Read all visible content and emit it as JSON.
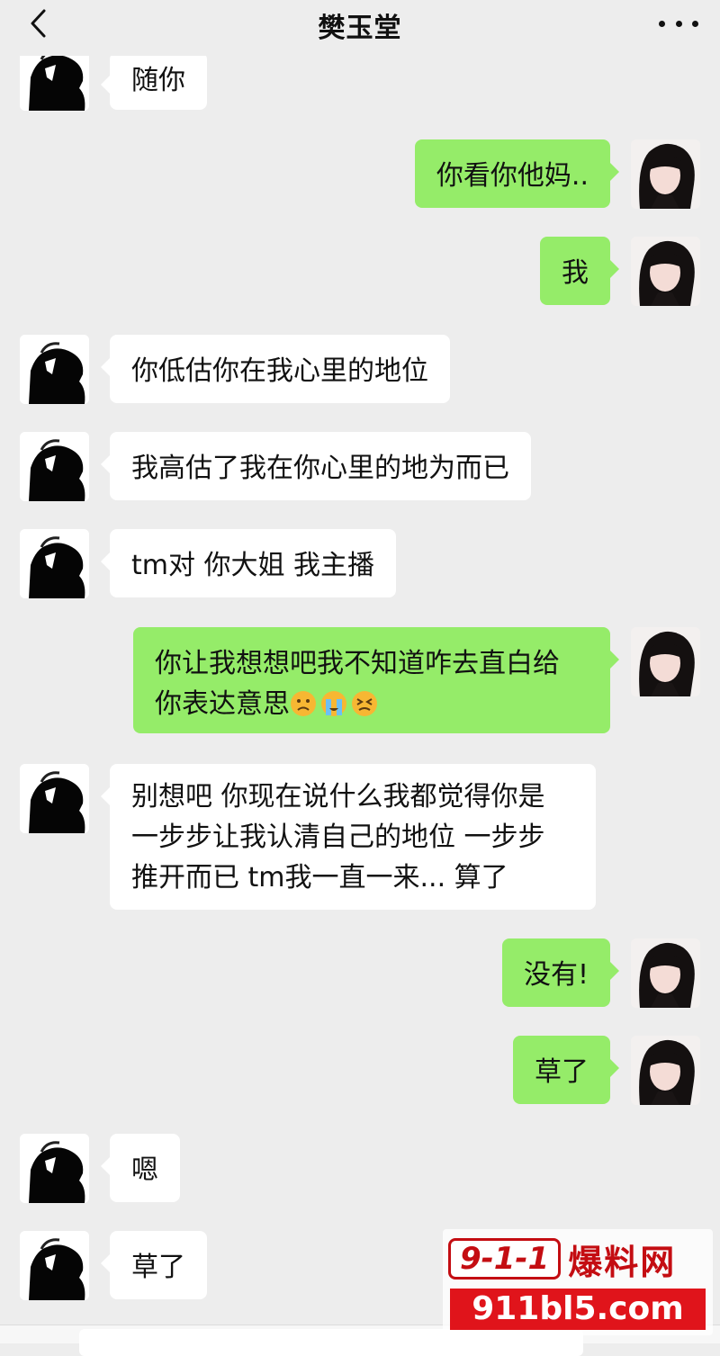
{
  "header": {
    "title": "樊玉堂",
    "back_icon": "chevron-left-icon",
    "more_icon": "ellipsis-icon"
  },
  "messages": [
    {
      "sender": "other",
      "lines": [
        "随你"
      ]
    },
    {
      "sender": "self",
      "lines": [
        "你看你他妈.."
      ]
    },
    {
      "sender": "self",
      "lines": [
        "我"
      ]
    },
    {
      "sender": "other",
      "lines": [
        "你低估你在我心里的地位"
      ]
    },
    {
      "sender": "other",
      "lines": [
        "我高估了我在你心里的地为而已"
      ]
    },
    {
      "sender": "other",
      "lines": [
        "tm对 你大姐 我主播"
      ]
    },
    {
      "sender": "self",
      "lines": [
        "你让我想想吧我不知道咋去直白给",
        "你表达意思"
      ],
      "emojis": [
        "frowning-face-emoji",
        "crying-face-emoji",
        "persevering-face-emoji"
      ]
    },
    {
      "sender": "other",
      "lines": [
        "别想吧 你现在说什么我都觉得你是",
        "一步步让我认清自己的地位 一步步",
        "推开而已 tm我一直一来... 算了"
      ]
    },
    {
      "sender": "self",
      "lines": [
        "没有!"
      ]
    },
    {
      "sender": "self",
      "lines": [
        "草了"
      ]
    },
    {
      "sender": "other",
      "lines": [
        "嗯"
      ]
    },
    {
      "sender": "other",
      "lines": [
        "草了"
      ]
    }
  ],
  "watermark": {
    "badge": "9-1-1",
    "name": "爆料网",
    "url": "911bl5.com"
  },
  "colors": {
    "self_bubble": "#95ec69",
    "other_bubble": "#ffffff",
    "background": "#ededed",
    "watermark_red": "#e0141b"
  }
}
